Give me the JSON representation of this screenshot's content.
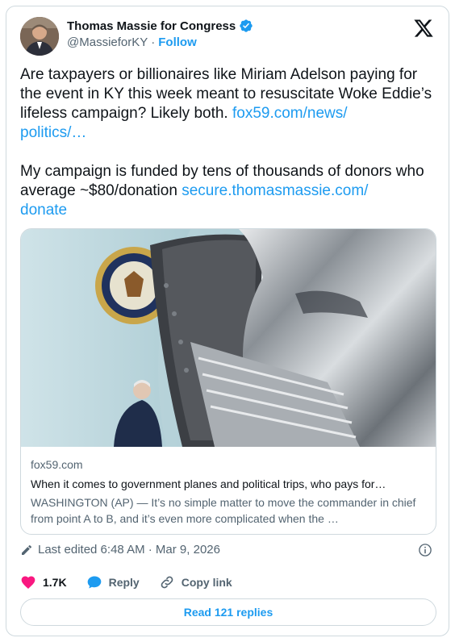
{
  "author": {
    "name": "Thomas Massie for Congress",
    "handle": "@MassieforKY",
    "separator": "·",
    "follow_label": "Follow"
  },
  "tweet": {
    "line1": "Are taxpayers or billionaires like Miriam Adelson paying for the event in KY this week meant to resuscitate Woke Eddie’s lifeless campaign? Likely both. ",
    "link1": "fox59.com/news/\npolitics/…",
    "line2": "\n\nMy campaign is funded by tens of thousands of donors who average ~$80/donation ",
    "link2": "secure.thomasmassie.com/\ndonate"
  },
  "link_card": {
    "domain": "fox59.com",
    "headline": "When it comes to government planes and political trips, who pays for…",
    "summary": "WASHINGTON (AP) — It’s no simple matter to move the commander in chief from point A to B, and it’s even more complicated when the …"
  },
  "meta": {
    "edited": "Last edited 6:48 AM · Mar 9, 2026"
  },
  "actions": {
    "likes": "1.7K",
    "reply_label": "Reply",
    "copy_label": "Copy link"
  },
  "read_replies": "Read 121 replies",
  "colors": {
    "accent": "#1d9bf0",
    "like": "#f91880",
    "secondary_text": "#536471"
  }
}
